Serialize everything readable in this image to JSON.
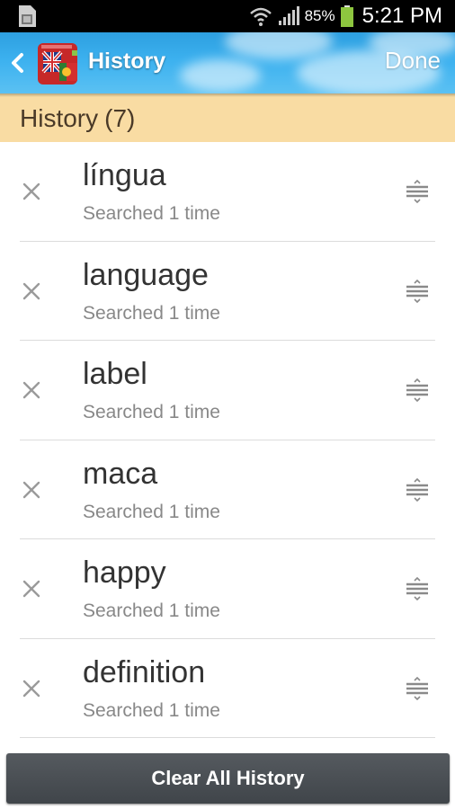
{
  "status_bar": {
    "battery_percent": "85%",
    "time": "5:21 PM",
    "icons": [
      "sim-card-icon",
      "wifi-icon",
      "signal-icon",
      "battery-icon"
    ]
  },
  "action_bar": {
    "title": "History",
    "done_label": "Done",
    "icons": [
      "back-arrow-icon",
      "dictionary-app-icon"
    ],
    "colors": {
      "bar": "#3cb1ef",
      "title_text": "#ffffff"
    }
  },
  "section": {
    "title": "History",
    "count": "(7)",
    "color": "#f9dca3"
  },
  "history": [
    {
      "word": "língua",
      "meta": "Searched 1 time"
    },
    {
      "word": "language",
      "meta": "Searched 1 time"
    },
    {
      "word": "label",
      "meta": "Searched 1 time"
    },
    {
      "word": "maca",
      "meta": "Searched 1 time"
    },
    {
      "word": "happy",
      "meta": "Searched 1 time"
    },
    {
      "word": "definition",
      "meta": "Searched 1 time"
    }
  ],
  "row_icons": {
    "delete": "close-icon",
    "drag": "drag-handle-icon"
  },
  "footer": {
    "clear_label": "Clear All History"
  }
}
